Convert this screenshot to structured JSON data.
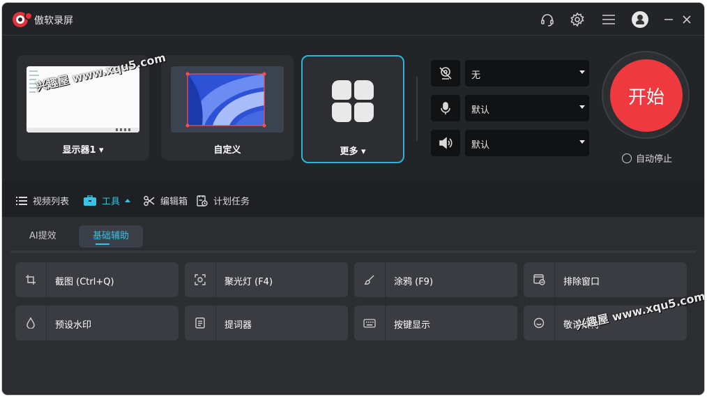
{
  "app": {
    "title": "傲软录屏"
  },
  "titlebar": {
    "icons": [
      "headset-icon",
      "gear-icon",
      "menu-icon",
      "avatar",
      "minimize-icon",
      "close-icon"
    ]
  },
  "sources": {
    "display": {
      "label": "显示器1"
    },
    "custom": {
      "label": "自定义"
    },
    "more": {
      "label": "更多"
    }
  },
  "devices": {
    "camera": {
      "value": "无",
      "icon": "camera-off-icon"
    },
    "microphone": {
      "value": "默认",
      "icon": "microphone-icon"
    },
    "speaker": {
      "value": "默认",
      "icon": "speaker-icon"
    }
  },
  "record": {
    "start_label": "开始",
    "auto_stop_label": "自动停止"
  },
  "nav": {
    "tabs": [
      {
        "label": "视频列表",
        "icon": "list-icon"
      },
      {
        "label": "工具",
        "icon": "toolbox-icon",
        "active": true
      },
      {
        "label": "编辑箱",
        "icon": "scissors-icon"
      },
      {
        "label": "计划任务",
        "icon": "schedule-icon"
      }
    ]
  },
  "subtabs": [
    {
      "label": "AI提效"
    },
    {
      "label": "基础辅助",
      "active": true
    }
  ],
  "tools": [
    {
      "label": "截图 (Ctrl+Q)",
      "icon": "crop-icon"
    },
    {
      "label": "聚光灯 (F4)",
      "icon": "spotlight-icon"
    },
    {
      "label": "涂鸦 (F9)",
      "icon": "brush-icon"
    },
    {
      "label": "排除窗口",
      "icon": "exclude-window-icon"
    },
    {
      "label": "预设水印",
      "icon": "watermark-icon"
    },
    {
      "label": "提词器",
      "icon": "teleprompter-icon"
    },
    {
      "label": "按键显示",
      "icon": "keyboard-icon"
    },
    {
      "label": "敬请期待",
      "icon": "smile-icon"
    }
  ],
  "watermarks": [
    "兴趣屋 www.xqu5.com",
    "兴趣屋 www.xqu5.com"
  ],
  "colors": {
    "accent": "#36c3e6",
    "record": "#ee3a3e",
    "background": "#222427"
  }
}
